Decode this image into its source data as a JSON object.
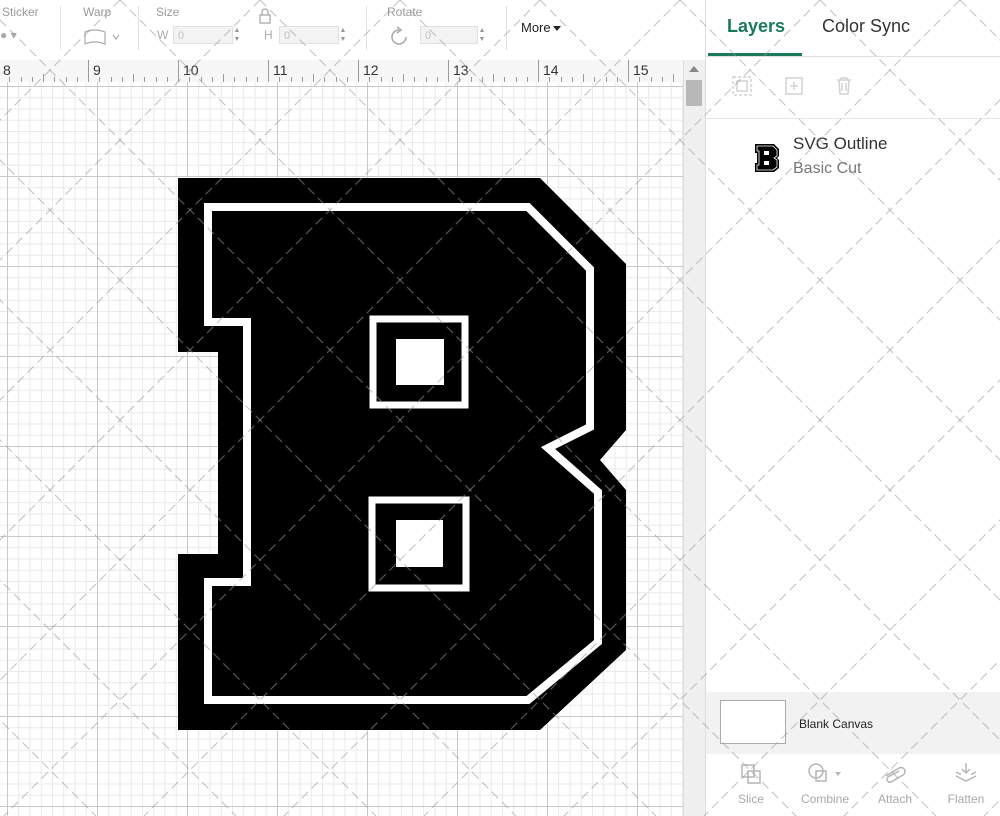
{
  "toolbar": {
    "sticker_label": "Sticker",
    "warp_label": "Warp",
    "size_label": "Size",
    "rotate_label": "Rotate",
    "size_w_label": "W",
    "size_w_value": "0",
    "size_h_label": "H",
    "size_h_value": "0",
    "rotate_value": "0",
    "more_label": "More"
  },
  "ruler": {
    "numbers": [
      "8",
      "9",
      "10",
      "11",
      "12",
      "13",
      "14",
      "15"
    ]
  },
  "panel": {
    "tabs": [
      {
        "label": "Layers",
        "active": true
      },
      {
        "label": "Color Sync",
        "active": false
      }
    ],
    "layers": [
      {
        "name": "SVG Outline",
        "operation": "Basic Cut",
        "thumb_letter": "B"
      }
    ],
    "blank_canvas_label": "Blank Canvas",
    "bottom_actions": [
      {
        "label": "Slice",
        "icon": "slice-icon"
      },
      {
        "label": "Combine",
        "icon": "combine-icon"
      },
      {
        "label": "Attach",
        "icon": "attach-icon"
      },
      {
        "label": "Flatten",
        "icon": "flatten-icon"
      }
    ]
  },
  "colors": {
    "accent": "#1b7a5a",
    "shape_fill": "#000000"
  },
  "icons": {
    "group": "group-icon",
    "ungroup": "ungroup-icon",
    "delete": "trash-icon",
    "lock": "lock-icon",
    "rotate": "rotate-icon",
    "warp": "warp-icon"
  }
}
